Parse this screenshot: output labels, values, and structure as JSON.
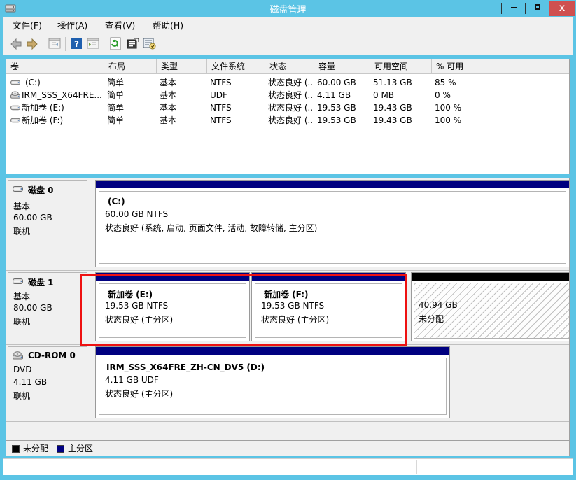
{
  "window": {
    "title": "磁盘管理",
    "icon": "disk-management-icon",
    "minimize_label": "—",
    "maximize_label": "❐",
    "close_label": "X",
    "accent_titlebar": "#5bc4e5",
    "close_color": "#cf5050"
  },
  "menu": [
    {
      "label": "文件(F)",
      "name": "menu-file"
    },
    {
      "label": "操作(A)",
      "name": "menu-action"
    },
    {
      "label": "查看(V)",
      "name": "menu-view"
    },
    {
      "label": "帮助(H)",
      "name": "menu-help"
    }
  ],
  "toolbar": [
    {
      "name": "back-icon",
      "title": "后退"
    },
    {
      "name": "forward-icon",
      "title": "前进"
    },
    {
      "name": "up-one-level-icon",
      "title": "向上"
    },
    {
      "name": "help-icon",
      "title": "帮助"
    },
    {
      "name": "show-hide-console-tree-icon",
      "title": "显示/隐藏控制台树"
    },
    {
      "name": "refresh-icon",
      "title": "刷新"
    },
    {
      "name": "properties-icon",
      "title": "属性"
    },
    {
      "name": "rescan-disks-icon",
      "title": "重新扫描磁盘"
    }
  ],
  "volume_list": {
    "columns": [
      {
        "label": "卷",
        "name": "column-volume"
      },
      {
        "label": "布局",
        "name": "column-layout"
      },
      {
        "label": "类型",
        "name": "column-type"
      },
      {
        "label": "文件系统",
        "name": "column-filesystem"
      },
      {
        "label": "状态",
        "name": "column-status"
      },
      {
        "label": "容量",
        "name": "column-capacity"
      },
      {
        "label": "可用空间",
        "name": "column-free-space"
      },
      {
        "label": "% 可用",
        "name": "column-percent-free"
      },
      {
        "label": "",
        "name": "column-blank"
      }
    ],
    "rows": [
      {
        "icon": "hard-disk-icon",
        "volume": "(C:)",
        "layout": "简单",
        "type": "基本",
        "filesystem": "NTFS",
        "status": "状态良好 (...",
        "capacity": "60.00 GB",
        "free": "51.13 GB",
        "percent": "85 %"
      },
      {
        "icon": "cd-rom-icon",
        "volume": "IRM_SSS_X64FRE...",
        "layout": "简单",
        "type": "基本",
        "filesystem": "UDF",
        "status": "状态良好 (...",
        "capacity": "4.11 GB",
        "free": "0 MB",
        "percent": "0 %"
      },
      {
        "icon": "hard-disk-icon",
        "volume": "新加卷 (E:)",
        "layout": "简单",
        "type": "基本",
        "filesystem": "NTFS",
        "status": "状态良好 (...",
        "capacity": "19.53 GB",
        "free": "19.43 GB",
        "percent": "100 %"
      },
      {
        "icon": "hard-disk-icon",
        "volume": "新加卷 (F:)",
        "layout": "简单",
        "type": "基本",
        "filesystem": "NTFS",
        "status": "状态良好 (...",
        "capacity": "19.53 GB",
        "free": "19.43 GB",
        "percent": "100 %"
      }
    ]
  },
  "disks": [
    {
      "name": "磁盘 0",
      "icon": "hard-disk-icon",
      "type": "基本",
      "size": "60.00 GB",
      "state": "联机",
      "partitions": [
        {
          "title": "(C:)",
          "size_fs": "60.00 GB NTFS",
          "status": "状态良好 (系统, 启动, 页面文件, 活动, 故障转储, 主分区)",
          "bar_color": "#000080",
          "kind": "primary"
        }
      ]
    },
    {
      "name": "磁盘 1",
      "icon": "hard-disk-icon",
      "type": "基本",
      "size": "80.00 GB",
      "state": "联机",
      "partitions": [
        {
          "title": "新加卷 (E:)",
          "size_fs": "19.53 GB NTFS",
          "status": "状态良好 (主分区)",
          "bar_color": "#000080",
          "kind": "primary"
        },
        {
          "title": "新加卷 (F:)",
          "size_fs": "19.53 GB NTFS",
          "status": "状态良好 (主分区)",
          "bar_color": "#000080",
          "kind": "primary"
        },
        {
          "title": "",
          "size_fs": "40.94 GB",
          "status": "未分配",
          "bar_color": "#000000",
          "kind": "unallocated"
        }
      ]
    },
    {
      "name": "CD-ROM 0",
      "icon": "cd-rom-icon",
      "type": "DVD",
      "size": "4.11 GB",
      "state": "联机",
      "partitions": [
        {
          "title": "IRM_SSS_X64FRE_ZH-CN_DV5  (D:)",
          "size_fs": "4.11 GB UDF",
          "status": "状态良好 (主分区)",
          "bar_color": "#000080",
          "kind": "primary"
        }
      ]
    }
  ],
  "legend": [
    {
      "label": "未分配",
      "color": "#000000",
      "name": "legend-unallocated"
    },
    {
      "label": "主分区",
      "color": "#000080",
      "name": "legend-primary-partition"
    }
  ],
  "highlight": {
    "color": "#ee1111",
    "target": "disk-1-partitions"
  },
  "statusbar": {
    "pane1": "",
    "pane2": "",
    "pane3": ""
  }
}
